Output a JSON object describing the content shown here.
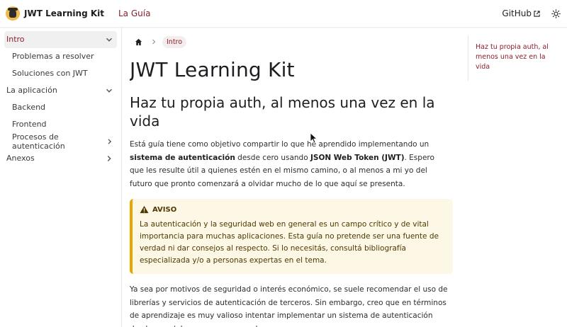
{
  "navbar": {
    "brand_title": "JWT Learning Kit",
    "guide_link": "La Guía",
    "github_link": "GitHub",
    "logo_icon": "bulldog-logo",
    "external_icon": "external-link-icon",
    "theme_icon": "sun-icon"
  },
  "sidebar": {
    "items": [
      {
        "label": "Intro",
        "expandable": true,
        "expanded": true,
        "active": true
      },
      {
        "label": "Problemas a resolver",
        "sub": true
      },
      {
        "label": "Soluciones con JWT",
        "sub": true
      },
      {
        "label": "La aplicación",
        "expandable": true,
        "expanded": true
      },
      {
        "label": "Backend",
        "sub": true
      },
      {
        "label": "Frontend",
        "sub": true
      },
      {
        "label": "Procesos de autenticación",
        "sub": true,
        "expandable": true,
        "expanded": false
      },
      {
        "label": "Anexos",
        "expandable": true,
        "expanded": false
      }
    ]
  },
  "breadcrumbs": {
    "home_icon": "home-icon",
    "current": "Intro"
  },
  "content": {
    "title": "JWT Learning Kit",
    "subtitle": "Haz tu propia auth, al menos una vez en la vida",
    "intro_part1": "Está guía tiene como objetivo compartir lo que he aprendido implementando un ",
    "intro_bold1": "sistema de autenticación",
    "intro_part2": " desde cero usando ",
    "intro_bold2": "JSON Web Token (JWT)",
    "intro_part3": ". Espero que les resulte útil a quienes estén en el mismo camino, o al menos a mi yo del futuro que pronto comenzará a olvidar mucho de lo que aquí se presenta.",
    "admonition_title": "AVISO",
    "admonition_text": "La autenticación y la seguridad web en general es un campo crítico y de vital importancia para muchas aplicaciones. Esta guía no pretende ser una fuente de verdad ni dar consejos al respecto. Si lo necesitás, consultá bibliografía especializada y/o a personas expertas en el tema.",
    "paragraph2": "Ya sea por motivos de seguridad o interés económico, se suele recomendar el uso de librerías y servicios de autenticación de terceros. Sin embargo, creo que en términos de aprendizaje es muy valioso intentar implementar un sistema de autenticación desde cero (al menos una vez en la"
  },
  "toc": {
    "items": [
      "Haz tu propia auth, al menos una vez en la vida"
    ]
  },
  "colors": {
    "accent": "#8b1d2c",
    "warning_border": "#e6a700",
    "warning_bg": "#fdf8e6",
    "active_bg": "#f0f0f0"
  }
}
